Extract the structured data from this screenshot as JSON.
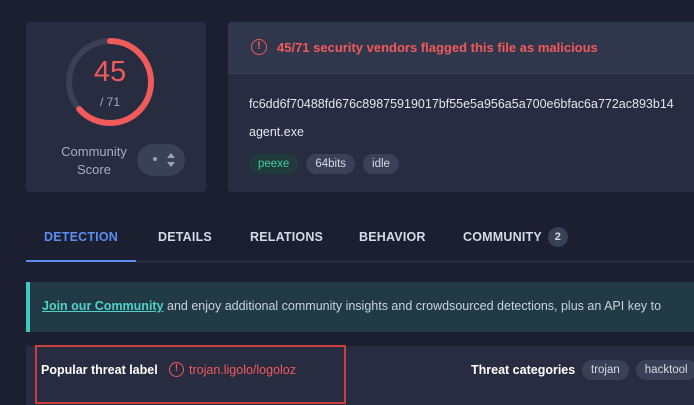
{
  "score": {
    "detections": "45",
    "total": "/ 71",
    "community_label": "Community Score",
    "ring_fraction": 0.634,
    "ring_color": "#f05a5a"
  },
  "file": {
    "alert": "45/71 security vendors flagged this file as malicious",
    "alert_icon": "alert-circle-icon",
    "hash": "fc6dd6f70488fd676c89875919017bf55e5a956a5a700e6bfac6a772ac893b14",
    "name": "agent.exe",
    "tags": [
      "peexe",
      "64bits",
      "idle"
    ]
  },
  "tabs": [
    {
      "label": "DETECTION",
      "active": true
    },
    {
      "label": "DETAILS"
    },
    {
      "label": "RELATIONS"
    },
    {
      "label": "BEHAVIOR"
    },
    {
      "label": "COMMUNITY",
      "badge": "2"
    }
  ],
  "banner": {
    "link": "Join our Community",
    "text": " and enjoy additional community insights and crowdsourced detections, plus an API key to"
  },
  "threat": {
    "popular_label": "Popular threat label",
    "value": "trojan.ligolo/logoloz",
    "categories_label": "Threat categories",
    "categories": [
      "trojan",
      "hacktool"
    ]
  },
  "colors": {
    "accent": "#5b8ef0",
    "danger": "#f05a5a",
    "highlight_box": "#c9403e"
  }
}
